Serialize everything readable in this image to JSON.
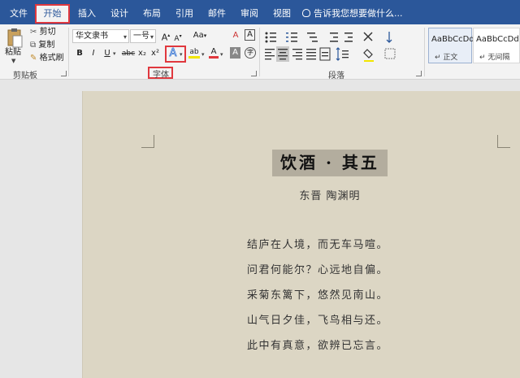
{
  "tabs": [
    "文件",
    "开始",
    "插入",
    "设计",
    "布局",
    "引用",
    "邮件",
    "审阅",
    "视图"
  ],
  "active_tab": "开始",
  "tell_me": "告诉我您想要做什么...",
  "clipboard": {
    "paste": "粘贴",
    "cut": "剪切",
    "copy": "复制",
    "format_painter": "格式刷",
    "group_label": "剪贴板"
  },
  "font": {
    "font_name": "华文隶书",
    "font_size": "一号",
    "grow_glyph": "A",
    "shrink_glyph": "A",
    "case_glyph": "Aa",
    "clear_glyph": "A",
    "bold": "B",
    "italic": "I",
    "underline": "U",
    "strike": "abc",
    "subscript": "x₂",
    "superscript": "x²",
    "text_effect_glyph": "A",
    "highlight_glyph": "ab",
    "font_color_glyph": "A",
    "char_shading_glyph": "A",
    "enclose_glyph": "字",
    "group_label": "字体"
  },
  "paragraph": {
    "group_label": "段落"
  },
  "styles": [
    {
      "sample": "AaBbCcDd",
      "name": "↵ 正文"
    },
    {
      "sample": "AaBbCcDd",
      "name": "↵ 无间隔"
    }
  ],
  "document": {
    "title": "饮酒 · 其五",
    "author": "东晋  陶渊明",
    "lines": [
      "结庐在人境，而无车马喧。",
      "问君何能尔？心远地自偏。",
      "采菊东篱下，悠然见南山。",
      "山气日夕佳，飞鸟相与还。",
      "此中有真意，欲辨已忘言。"
    ]
  },
  "colors": {
    "tab_bar": "#2b579a",
    "highlight_frame": "#e0383e",
    "page_background": "#dcd6c4",
    "font_color": "#e0383e",
    "highlight_color": "#f2e500"
  }
}
